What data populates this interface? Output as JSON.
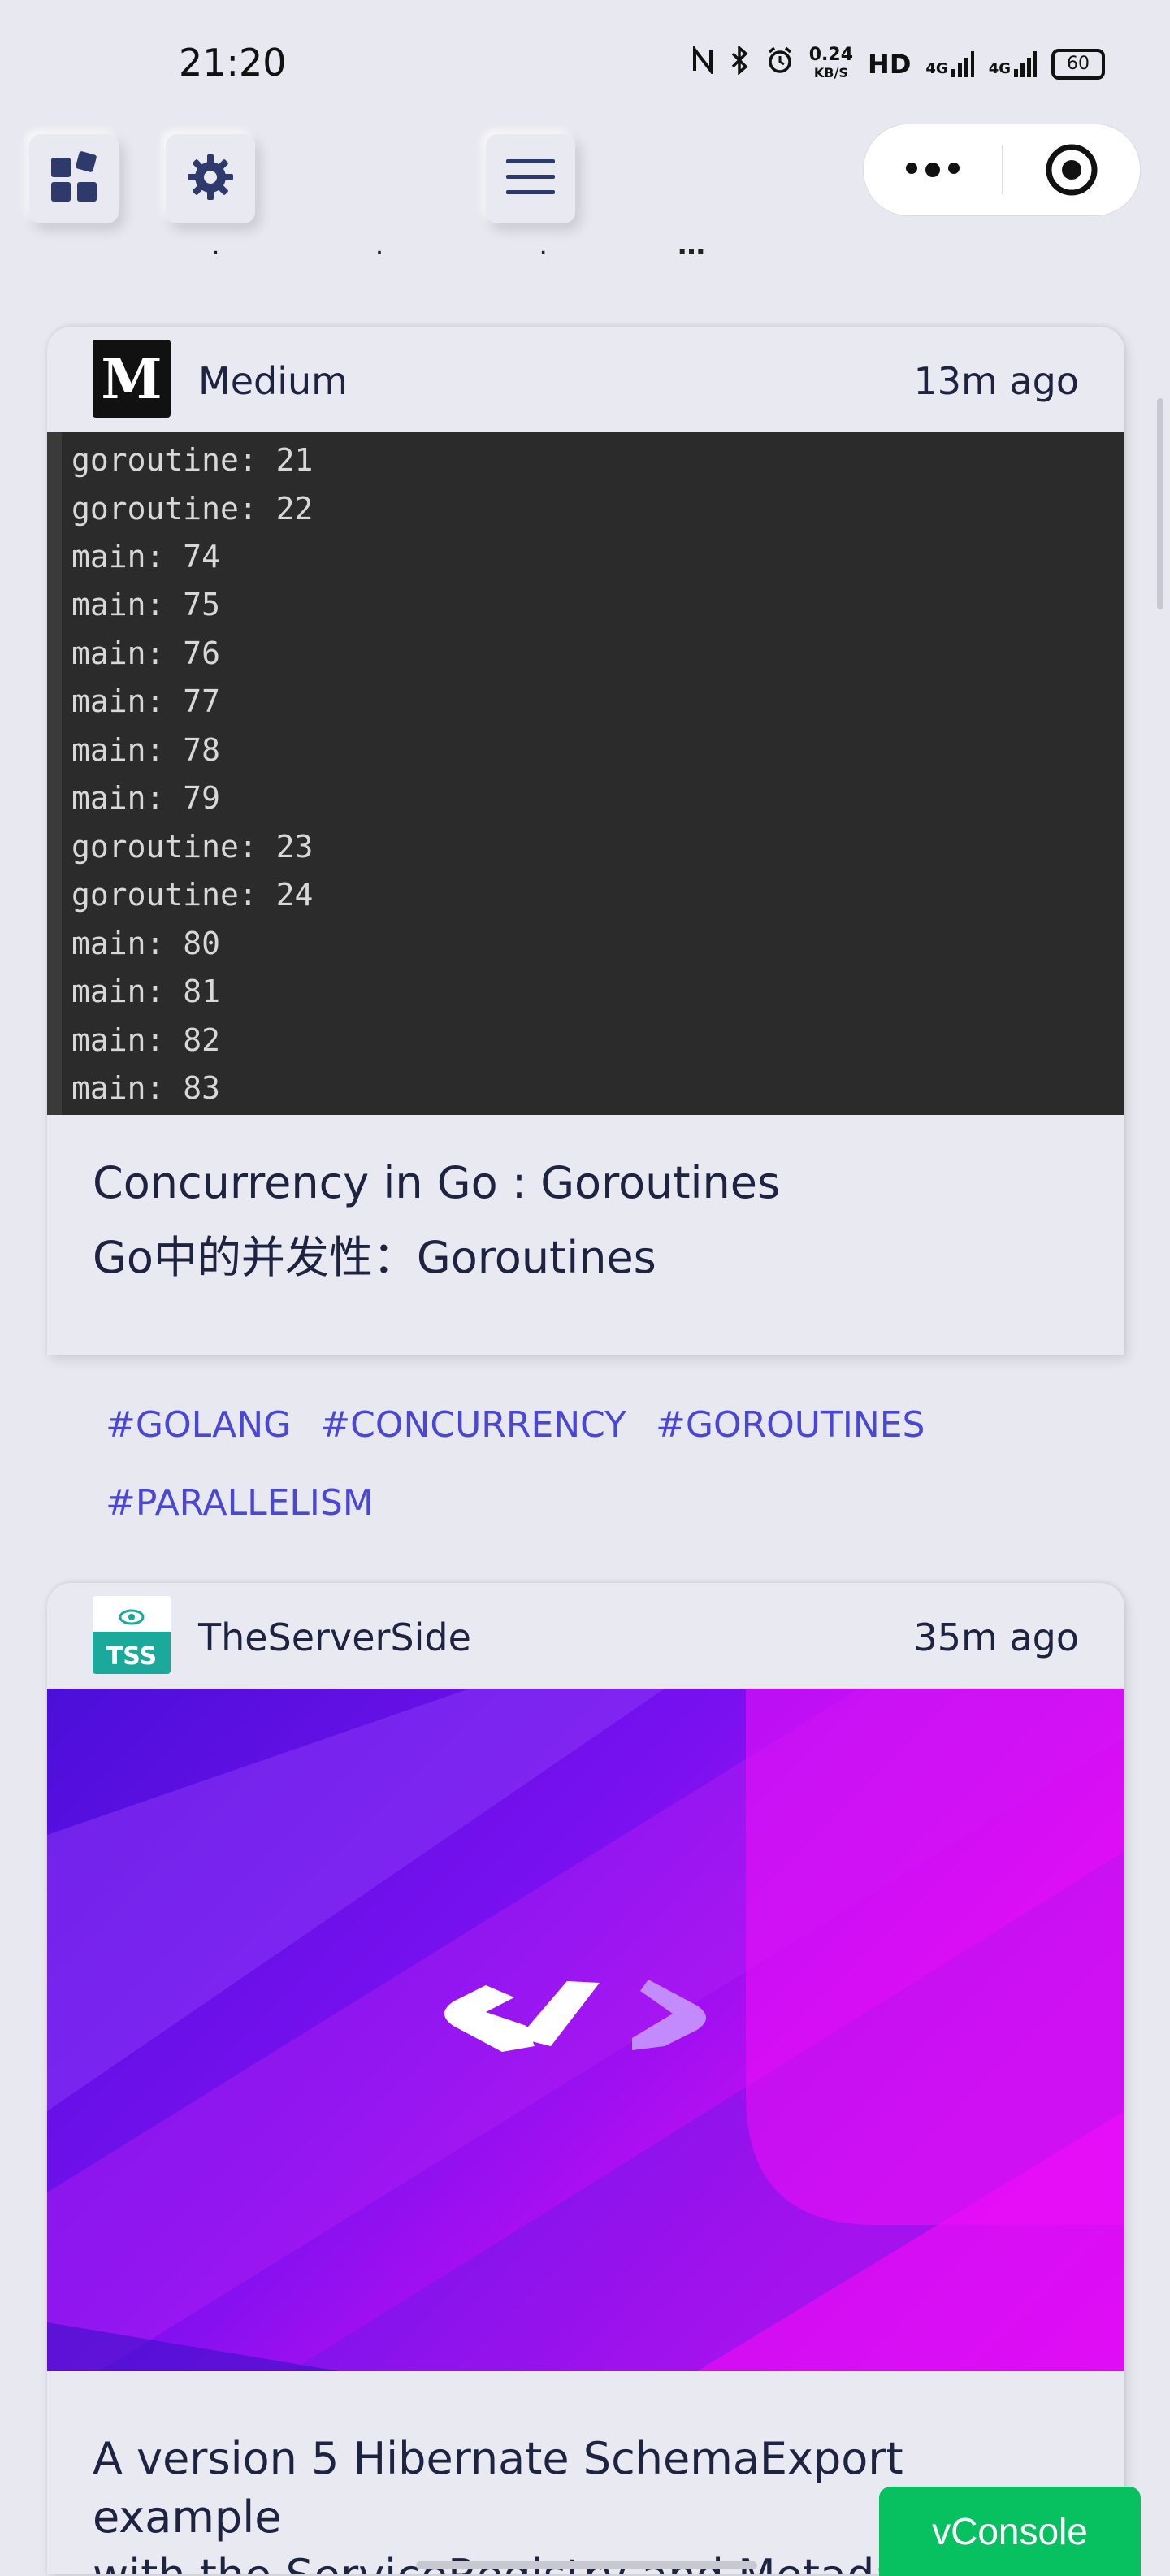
{
  "status_bar": {
    "time": "21:20",
    "speed_value": "0.24",
    "speed_unit": "KB/S",
    "hd": "HD",
    "net1": "4G",
    "net2": "4G",
    "battery": "60",
    "icons": [
      "nfc-icon",
      "bluetooth-icon",
      "alarm-icon",
      "signal-icon",
      "battery-icon"
    ]
  },
  "toolbar": {
    "icons": [
      "dashboard-icon",
      "gear-icon",
      "menu-icon",
      "more-icon",
      "close-capsule-icon"
    ],
    "partial_text": "…"
  },
  "feed": [
    {
      "source": "Medium",
      "time": "13m ago",
      "image_type": "code-screenshot",
      "code_lines": [
        "goroutine: 21",
        "goroutine: 22",
        "main: 74",
        "main: 75",
        "main: 76",
        "main: 77",
        "main: 78",
        "main: 79",
        "goroutine: 23",
        "goroutine: 24",
        "main: 80",
        "main: 81",
        "main: 82",
        "main: 83"
      ],
      "title_en": "Concurrency in Go : Goroutines",
      "title_zh": "Go中的并发性：Goroutines",
      "tags": [
        "#GOLANG",
        "#CONCURRENCY",
        "#GOROUTINES",
        "#PARALLELISM"
      ]
    },
    {
      "source": "TheServerSide",
      "source_logo_text": "TSS",
      "time": "35m ago",
      "image_type": "purple-hero",
      "title_line1": "A version 5 Hibernate SchemaExport example",
      "title_line2": "with the ServiceRegistry and Metadat"
    }
  ],
  "vconsole": {
    "label": "vConsole"
  },
  "colors": {
    "background": "#e8e8f0",
    "tag": "#4a47d6",
    "vconsole": "#07c160",
    "text": "#1d2340"
  }
}
